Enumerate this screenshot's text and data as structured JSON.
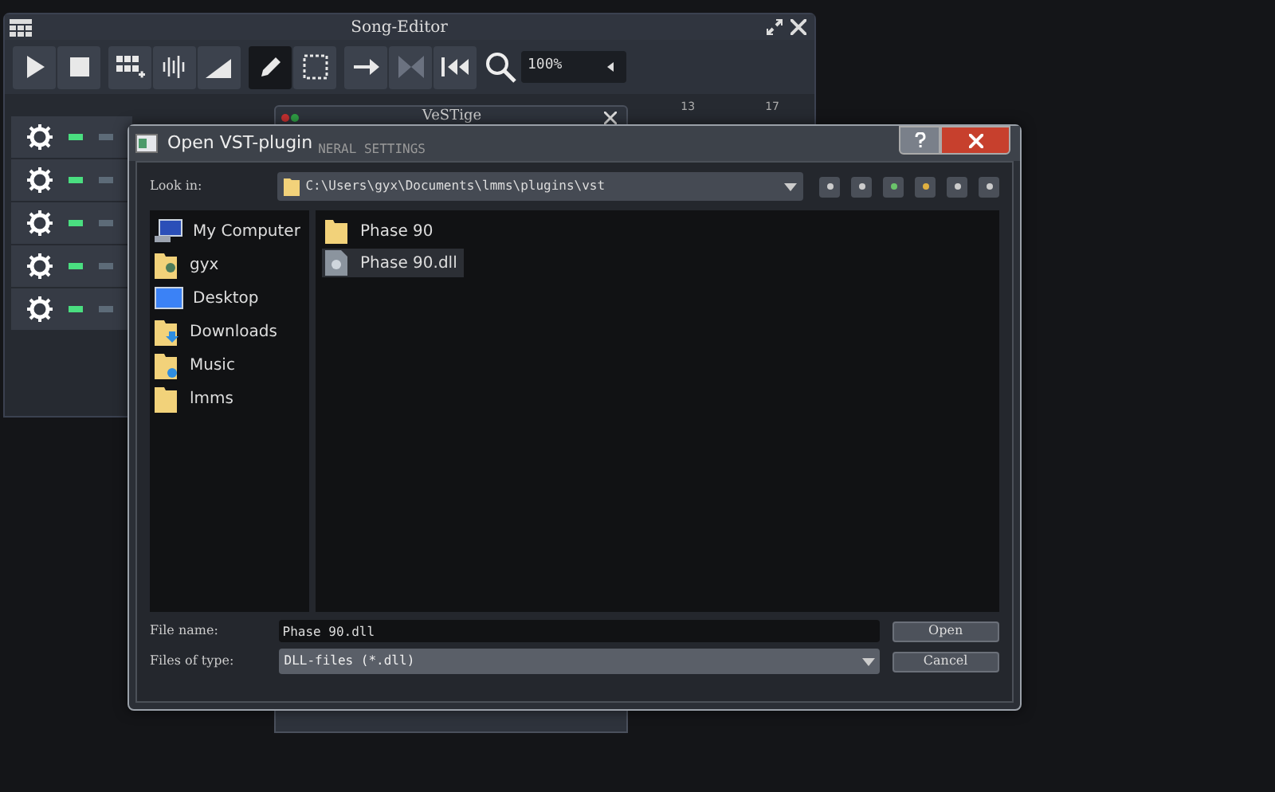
{
  "song_editor": {
    "title": "Song-Editor",
    "toolbar": [
      {
        "kind": "play",
        "selected": false
      },
      {
        "kind": "stop",
        "selected": false
      },
      {
        "kind": "add-pattern",
        "selected": false
      },
      {
        "kind": "add-sample",
        "selected": false
      },
      {
        "kind": "add-automation",
        "selected": false
      },
      {
        "kind": "draw",
        "selected": true
      },
      {
        "kind": "select",
        "selected": false
      },
      {
        "kind": "arrow",
        "selected": false
      },
      {
        "kind": "bowtie",
        "selected": false
      },
      {
        "kind": "skip",
        "selected": false
      }
    ],
    "zoom": "100%",
    "ruler": [
      "13",
      "17"
    ],
    "tracks": [
      {
        "active": true
      },
      {
        "active": true
      },
      {
        "active": true
      },
      {
        "active": true
      },
      {
        "active": true
      }
    ]
  },
  "vestige": {
    "title": "VeSTige",
    "section": "NERAL SETTINGS"
  },
  "dialog": {
    "title": "Open VST-plugin",
    "look_in_label": "Look in:",
    "path": "C:\\Users\\gyx\\Documents\\lmms\\plugins\\vst",
    "places": [
      {
        "label": "My Computer",
        "kind": "computer"
      },
      {
        "label": "gyx",
        "kind": "user"
      },
      {
        "label": "Desktop",
        "kind": "desktop"
      },
      {
        "label": "Downloads",
        "kind": "downloads"
      },
      {
        "label": "Music",
        "kind": "music"
      },
      {
        "label": "lmms",
        "kind": "folder"
      }
    ],
    "files": [
      {
        "name": "Phase 90",
        "kind": "folder",
        "selected": false
      },
      {
        "name": "Phase 90.dll",
        "kind": "file",
        "selected": true
      }
    ],
    "file_name_label": "File name:",
    "file_name": "Phase 90.dll",
    "type_label": "Files of type:",
    "type_value": "DLL-files (*.dll)",
    "buttons": [
      "Open",
      "Cancel"
    ]
  }
}
